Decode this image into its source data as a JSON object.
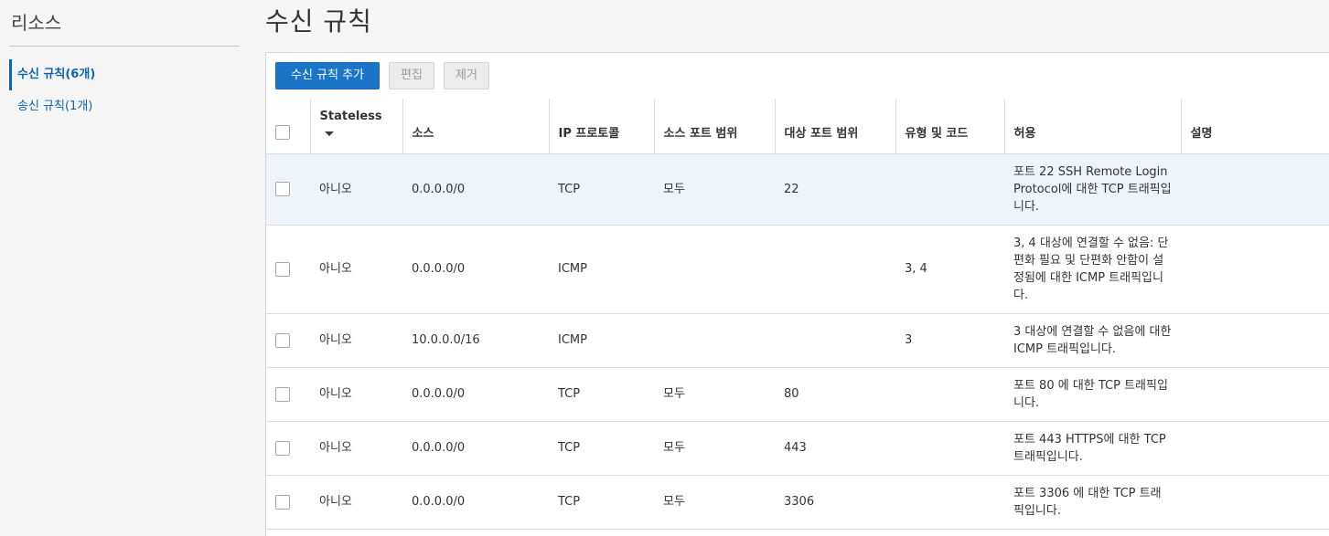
{
  "sidebar": {
    "title": "리소스",
    "items": [
      {
        "label": "수신 규칙(6개)",
        "active": true
      },
      {
        "label": "송신 규칙(1개)",
        "active": false
      }
    ]
  },
  "page": {
    "title": "수신 규칙"
  },
  "toolbar": {
    "add_label": "수신 규칙 추가",
    "edit_label": "편집",
    "delete_label": "제거"
  },
  "table": {
    "columns": {
      "stateless": "Stateless",
      "source": "소스",
      "ip_protocol": "IP 프로토콜",
      "source_port_range": "소스 포트 범위",
      "dest_port_range": "대상 포트 범위",
      "type_code": "유형 및 코드",
      "allows": "허용",
      "description": "설명"
    },
    "rows": [
      {
        "stateless": "아니오",
        "source": "0.0.0.0/0",
        "protocol": "TCP",
        "src_port": "모두",
        "dst_port": "22",
        "type_code": "",
        "allows": "포트 22 SSH Remote Login Protocol에 대한 TCP 트래픽입니다.",
        "description": ""
      },
      {
        "stateless": "아니오",
        "source": "0.0.0.0/0",
        "protocol": "ICMP",
        "src_port": "",
        "dst_port": "",
        "type_code": "3, 4",
        "allows": "3, 4 대상에 연결할 수 없음: 단편화 필요 및 단편화 안함이 설정됨에 대한 ICMP 트래픽입니다.",
        "description": ""
      },
      {
        "stateless": "아니오",
        "source": "10.0.0.0/16",
        "protocol": "ICMP",
        "src_port": "",
        "dst_port": "",
        "type_code": "3",
        "allows": "3 대상에 연결할 수 없음에 대한 ICMP 트래픽입니다.",
        "description": ""
      },
      {
        "stateless": "아니오",
        "source": "0.0.0.0/0",
        "protocol": "TCP",
        "src_port": "모두",
        "dst_port": "80",
        "type_code": "",
        "allows": "포트 80 에 대한 TCP 트래픽입니다.",
        "description": ""
      },
      {
        "stateless": "아니오",
        "source": "0.0.0.0/0",
        "protocol": "TCP",
        "src_port": "모두",
        "dst_port": "443",
        "type_code": "",
        "allows": "포트 443 HTTPS에 대한 TCP 트래픽입니다.",
        "description": ""
      },
      {
        "stateless": "아니오",
        "source": "0.0.0.0/0",
        "protocol": "TCP",
        "src_port": "모두",
        "dst_port": "3306",
        "type_code": "",
        "allows": "포트 3306 에 대한 TCP 트래픽입니다.",
        "description": ""
      }
    ]
  },
  "colors": {
    "accent": "#1a74c8",
    "highlight_row": "#eef4f9"
  },
  "icons": {
    "sort": "caret-down-icon",
    "checkbox": "checkbox-icon"
  }
}
